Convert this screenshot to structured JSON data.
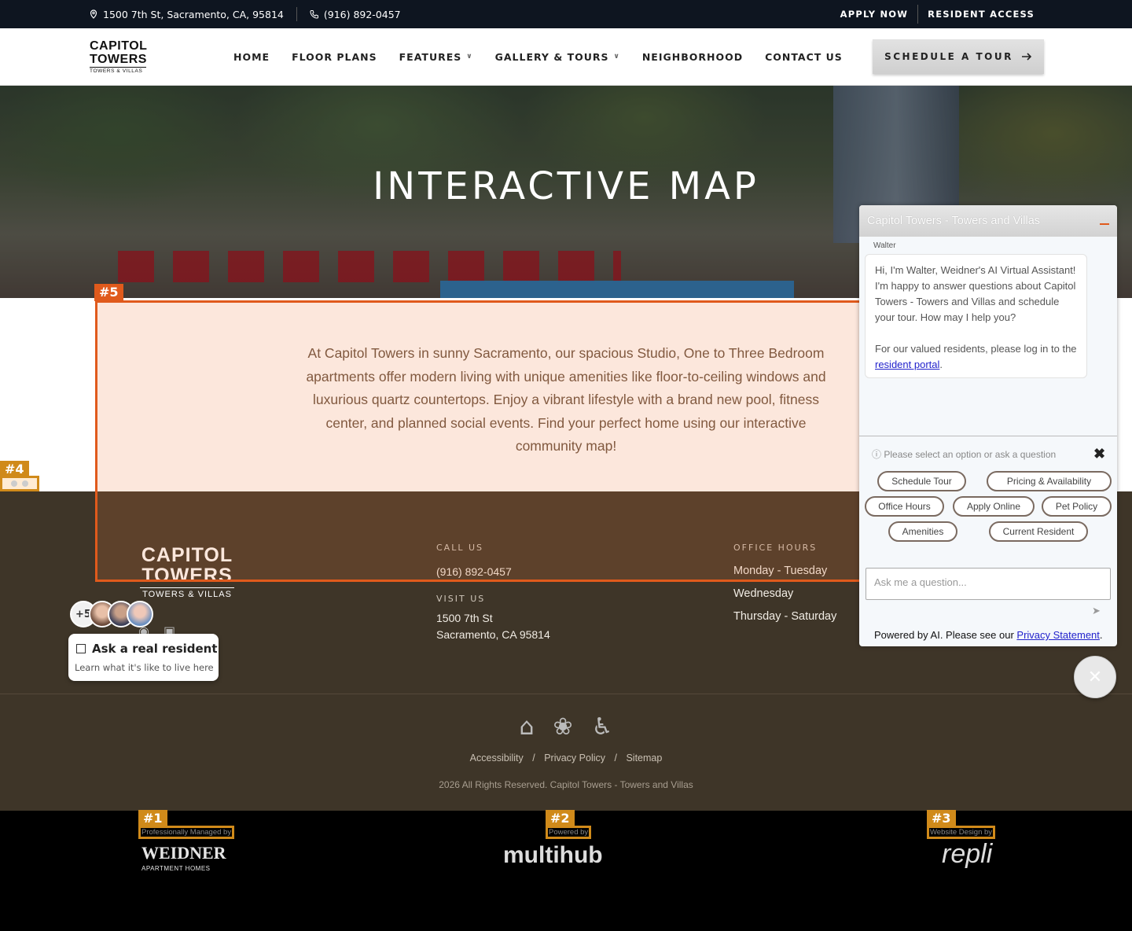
{
  "topbar": {
    "address": "1500 7th St, Sacramento, CA, 95814",
    "phone": "(916) 892-0457",
    "apply": "APPLY NOW",
    "resident": "RESIDENT ACCESS"
  },
  "logo": {
    "line1": "CAPITOL",
    "line2": "TOWERS",
    "line3": "TOWERS & VILLAS"
  },
  "nav": {
    "items": [
      {
        "label": "HOME"
      },
      {
        "label": "FLOOR PLANS"
      },
      {
        "label": "FEATURES"
      },
      {
        "label": "GALLERY & TOURS"
      },
      {
        "label": "NEIGHBORHOOD"
      },
      {
        "label": "CONTACT US"
      }
    ],
    "cta": "SCHEDULE A TOUR"
  },
  "hero": {
    "title": "INTERACTIVE MAP"
  },
  "intro": {
    "text": "At Capitol Towers in sunny Sacramento, our spacious Studio, One to Three Bedroom apartments offer modern living with unique amenities like floor-to-ceiling windows and luxurious quartz countertops. Enjoy a vibrant lifestyle with a brand new pool, fitness center, and planned social events. Find your perfect home using our interactive community map!"
  },
  "badges": {
    "b1": "#1",
    "b2": "#2",
    "b3": "#3",
    "b4": "#4",
    "b5": "#5"
  },
  "footer": {
    "logo1": "CAPITOL",
    "logo2": "TOWERS",
    "logo3": "TOWERS & VILLAS",
    "call_label": "CALL US",
    "call_value": "(916) 892-0457",
    "visit_label": "VISIT US",
    "visit_line1": "1500 7th St",
    "visit_line2": "Sacramento, CA 95814",
    "hours_label": "OFFICE HOURS",
    "hours": [
      "Monday - Tuesday",
      "Wednesday",
      "Thursday - Saturday"
    ]
  },
  "resident_widget": {
    "count": "+5",
    "title": "Ask a real resident",
    "subtitle": "Learn what it's like to live here"
  },
  "bottom": {
    "links": [
      "Accessibility",
      "Privacy Policy",
      "Sitemap"
    ],
    "separator": "/",
    "copyright": "2026 All Rights Reserved. Capitol Towers - Towers and Villas"
  },
  "credits": {
    "managed_label": "Professionally Managed by",
    "managed_name": "WEIDNER",
    "managed_sub": "APARTMENT HOMES",
    "powered_label": "Powered by",
    "powered_name": "multihub",
    "design_label": "Website Design by",
    "design_name": "repli"
  },
  "chat": {
    "title": "Capitol Towers - Towers and Villas",
    "agent": "Walter",
    "message1": "Hi, I'm Walter, Weidner's AI Virtual Assistant! I'm happy to answer questions about Capitol Towers - Towers and Villas and schedule your tour. How may I help you?",
    "message2": "For our valued residents, please log in to the",
    "portal_link": "resident portal",
    "hint": "Please select an option or ask a question",
    "options": [
      "Schedule Tour",
      "Pricing & Availability",
      "Office Hours",
      "Apply Online",
      "Pet Policy",
      "Amenities",
      "Current Resident"
    ],
    "input_placeholder": "Ask me a question...",
    "powered_text": "Powered by AI. Please see our",
    "privacy_link": "Privacy Statement"
  }
}
